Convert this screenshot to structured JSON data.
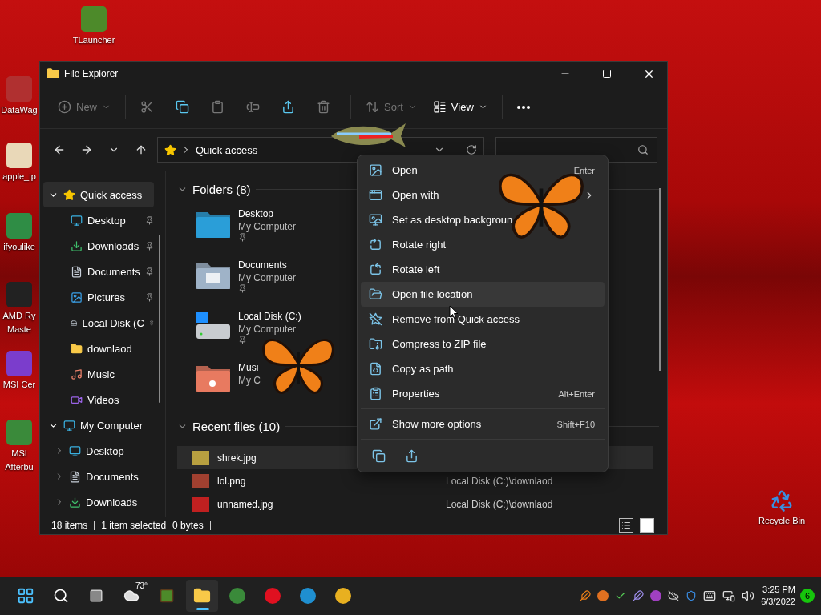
{
  "desktop_icons": [
    {
      "kind": "tlauncher",
      "lines": [
        "TLauncher"
      ]
    },
    {
      "kind": "datawag",
      "lines": [
        "DataWag"
      ]
    },
    {
      "kind": "phone",
      "lines": [
        "apple_ip"
      ]
    },
    {
      "kind": "chrome",
      "lines": [
        "ifyoulike"
      ]
    },
    {
      "kind": "amd",
      "lines": [
        "AMD Ry",
        "Maste"
      ]
    },
    {
      "kind": "msi",
      "lines": [
        "MSI Cer"
      ]
    },
    {
      "kind": "afterburner",
      "lines": [
        "MSI",
        "Afterbu"
      ]
    },
    {
      "kind": "recycle",
      "lines": [
        "Recycle Bin"
      ]
    }
  ],
  "window": {
    "title": "File Explorer",
    "toolbar": [
      {
        "kind": "new",
        "label": "New",
        "disabled": true
      },
      {
        "kind": "cut",
        "disabled": true
      },
      {
        "kind": "copy",
        "disabled": false
      },
      {
        "kind": "paste",
        "disabled": true
      },
      {
        "kind": "rename",
        "disabled": true
      },
      {
        "kind": "share",
        "disabled": false
      },
      {
        "kind": "delete",
        "disabled": true
      },
      {
        "kind": "sort",
        "label": "Sort",
        "disabled": true
      },
      {
        "kind": "view",
        "label": "View",
        "disabled": false
      },
      {
        "kind": "more",
        "disabled": false
      }
    ],
    "address": {
      "path": "Quick access"
    },
    "sidebar": [
      {
        "label": "Quick access",
        "kind": "star",
        "expanded": true,
        "selected": true,
        "children": [
          {
            "label": "Desktop",
            "kind": "desktop",
            "pinned": true,
            "selected": false
          },
          {
            "label": "Downloads",
            "kind": "downloads",
            "pinned": true,
            "selected": false
          },
          {
            "label": "Documents",
            "kind": "documents",
            "pinned": true,
            "selected": false
          },
          {
            "label": "Pictures",
            "kind": "pictures",
            "pinned": true,
            "selected": false
          },
          {
            "label": "Local Disk (C",
            "kind": "disk",
            "pinned": true,
            "selected": false
          },
          {
            "label": "downlaod",
            "kind": "folder",
            "pinned": false,
            "selected": false
          },
          {
            "label": "Music",
            "kind": "music",
            "pinned": false,
            "selected": false
          },
          {
            "label": "Videos",
            "kind": "videos",
            "pinned": false,
            "selected": false
          }
        ]
      },
      {
        "label": "My Computer",
        "kind": "computer",
        "expanded": true,
        "selected": false,
        "children": [
          {
            "label": "Desktop",
            "kind": "desktop",
            "expanded": false,
            "selected": false
          },
          {
            "label": "Documents",
            "kind": "documents",
            "expanded": false,
            "selected": false
          },
          {
            "label": "Downloads",
            "kind": "downloads",
            "expanded": false,
            "selected": false
          }
        ]
      }
    ],
    "folders": {
      "title": "Folders (8)",
      "expanded": true,
      "items": [
        {
          "name": "Desktop",
          "location": "My Computer",
          "kind": "desktop",
          "pinned": true
        },
        {
          "name": "Documents",
          "location": "My Computer",
          "kind": "documents",
          "pinned": true
        },
        {
          "name": "Local Disk (C:)",
          "location": "My Computer",
          "kind": "disk",
          "pinned": true
        },
        {
          "name": "Musi",
          "location": "My C",
          "kind": "music",
          "pinned": false
        }
      ]
    },
    "recent": {
      "title": "Recent files (10)",
      "expanded": true,
      "rows": [
        {
          "name": "shrek.jpg",
          "selected": true
        },
        {
          "name": "lol.png",
          "location": "Local Disk (C:)\\downlaod",
          "selected": false
        },
        {
          "name": "unnamed.jpg",
          "location": "Local Disk (C:)\\downlaod",
          "selected": false
        }
      ]
    },
    "status": {
      "items": "18 items",
      "selection": "1 item selected",
      "size": "0 bytes"
    },
    "view_modes": [
      {
        "kind": "details",
        "selected": false
      },
      {
        "kind": "tiles",
        "selected": true
      }
    ]
  },
  "context_menu": {
    "items": [
      {
        "kind": "open",
        "label": "Open",
        "shortcut": "Enter",
        "submenu": false,
        "selected": false
      },
      {
        "kind": "openwith",
        "label": "Open with",
        "submenu": true,
        "selected": false
      },
      {
        "kind": "wallpaper",
        "label": "Set as desktop backgroun",
        "submenu": false,
        "selected": false
      },
      {
        "kind": "rotright",
        "label": "Rotate right",
        "submenu": false,
        "selected": false
      },
      {
        "kind": "rotleft",
        "label": "Rotate left",
        "submenu": false,
        "selected": false
      },
      {
        "kind": "location",
        "label": "Open file location",
        "submenu": false,
        "selected": true
      },
      {
        "kind": "unpin",
        "label": "Remove from Quick access",
        "submenu": false,
        "selected": false
      },
      {
        "kind": "zip",
        "label": "Compress to ZIP file",
        "submenu": false,
        "selected": false
      },
      {
        "kind": "path",
        "label": "Copy as path",
        "submenu": false,
        "selected": false
      },
      {
        "kind": "properties",
        "label": "Properties",
        "shortcut": "Alt+Enter",
        "submenu": false,
        "selected": false
      }
    ],
    "more": {
      "label": "Show more options",
      "shortcut": "Shift+F10"
    },
    "actions": [
      {
        "kind": "copy"
      },
      {
        "kind": "share"
      }
    ]
  },
  "taskbar": {
    "apps": [
      {
        "kind": "start",
        "active": false
      },
      {
        "kind": "search",
        "active": false
      },
      {
        "kind": "taskview",
        "active": false
      },
      {
        "kind": "weather",
        "label": "73°",
        "active": false
      },
      {
        "kind": "minecraft",
        "active": false
      },
      {
        "kind": "explorer",
        "active": true
      },
      {
        "kind": "afterburner",
        "active": false
      },
      {
        "kind": "opera",
        "active": false
      },
      {
        "kind": "edge",
        "active": false
      },
      {
        "kind": "chrome",
        "active": false
      }
    ],
    "clock": {
      "time": "3:25 PM",
      "date": "6/3/2022"
    },
    "notifications": "6"
  }
}
